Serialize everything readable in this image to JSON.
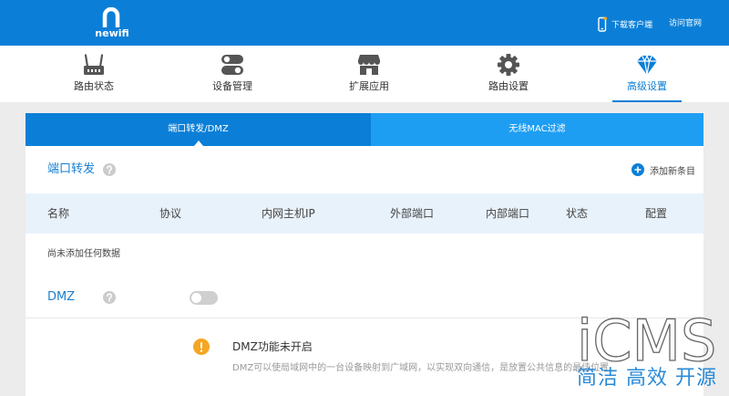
{
  "header": {
    "logo_text": "newifi",
    "download_client": "下载客户端",
    "visit_site": "访问官网"
  },
  "nav": {
    "items": [
      {
        "label": "路由状态",
        "icon": "router-icon",
        "active": false
      },
      {
        "label": "设备管理",
        "icon": "toggle-icon",
        "active": false
      },
      {
        "label": "扩展应用",
        "icon": "store-icon",
        "active": false
      },
      {
        "label": "路由设置",
        "icon": "gear-icon",
        "active": false
      },
      {
        "label": "高级设置",
        "icon": "diamond-icon",
        "active": true
      }
    ]
  },
  "tabs": [
    {
      "label": "端口转发/DMZ",
      "active": true
    },
    {
      "label": "无线MAC过滤",
      "active": false
    }
  ],
  "port_forward": {
    "title": "端口转发",
    "help_icon": "question-icon",
    "add_icon": "plus-circle-icon",
    "add_label": "添加新条目",
    "columns": [
      "名称",
      "协议",
      "内网主机IP",
      "外部端口",
      "内部端口",
      "状态",
      "配置"
    ],
    "rows": [],
    "empty_text": "尚未添加任何数据"
  },
  "dmz": {
    "title": "DMZ",
    "help_icon": "question-icon",
    "enabled": false,
    "status_icon": "warning-icon",
    "status_title": "DMZ功能未开启",
    "description": "DMZ可以使局域网中的一台设备映射到广域网，以实现双向通信，是放置公共信息的最佳位置"
  },
  "watermark": {
    "brand": "iCMS",
    "slogan": "简洁 高效 开源"
  },
  "colors": {
    "primary": "#0b7fd7",
    "tab_inactive": "#1e9ef2",
    "title_text": "#1a7fd0",
    "warning": "#f5a623",
    "table_header_bg": "#e8f2fb",
    "page_bg": "#ececec",
    "watermark_slogan": "#2a8ad8"
  }
}
